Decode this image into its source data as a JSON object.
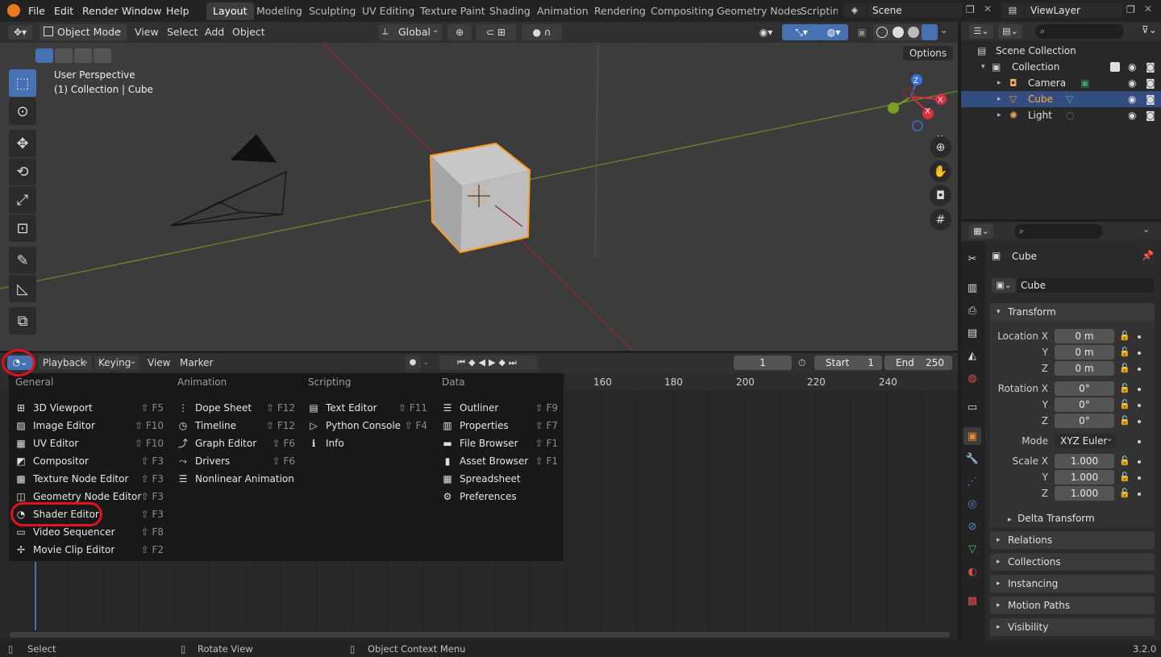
{
  "menubar": {
    "items": [
      "File",
      "Edit",
      "Render",
      "Window",
      "Help"
    ]
  },
  "workspaces": [
    "Layout",
    "Modeling",
    "Sculpting",
    "UV Editing",
    "Texture Paint",
    "Shading",
    "Animation",
    "Rendering",
    "Compositing",
    "Geometry Nodes",
    "Scripting"
  ],
  "scene": {
    "name": "Scene"
  },
  "view_layer": {
    "name": "ViewLayer"
  },
  "viewport_header": {
    "mode": "Object Mode",
    "menus": [
      "View",
      "Select",
      "Add",
      "Object"
    ],
    "orientation": "Global"
  },
  "viewport": {
    "perspective": "User Perspective",
    "context": "(1) Collection | Cube",
    "options": "Options"
  },
  "gizmo": {
    "z": "Z",
    "y": "Y",
    "x": "X"
  },
  "timeline_header": {
    "menus": [
      "Playback",
      "Keying",
      "View",
      "Marker"
    ],
    "current_frame": "1",
    "start_label": "Start",
    "start_value": "1",
    "end_label": "End",
    "end_value": "250"
  },
  "timeline_ticks": [
    "160",
    "180",
    "200",
    "220",
    "240"
  ],
  "editor_menu": {
    "columns": [
      {
        "title": "General",
        "items": [
          {
            "label": "3D Viewport",
            "shortcut": "⇧ F5",
            "icon": "viewport-icon"
          },
          {
            "label": "Image Editor",
            "shortcut": "⇧ F10",
            "icon": "image-icon"
          },
          {
            "label": "UV Editor",
            "shortcut": "⇧ F10",
            "icon": "uv-icon"
          },
          {
            "label": "Compositor",
            "shortcut": "⇧ F3",
            "icon": "compositor-icon"
          },
          {
            "label": "Texture Node Editor",
            "shortcut": "⇧ F3",
            "icon": "texture-icon"
          },
          {
            "label": "Geometry Node Editor",
            "shortcut": "⇧ F3",
            "icon": "geometry-nodes-icon"
          },
          {
            "label": "Shader Editor",
            "shortcut": "⇧ F3",
            "icon": "shader-icon"
          },
          {
            "label": "Video Sequencer",
            "shortcut": "⇧ F8",
            "icon": "sequencer-icon"
          },
          {
            "label": "Movie Clip Editor",
            "shortcut": "⇧ F2",
            "icon": "clip-icon"
          }
        ]
      },
      {
        "title": "Animation",
        "items": [
          {
            "label": "Dope Sheet",
            "shortcut": "⇧ F12",
            "icon": "dopesheet-icon"
          },
          {
            "label": "Timeline",
            "shortcut": "⇧ F12",
            "icon": "timeline-icon"
          },
          {
            "label": "Graph Editor",
            "shortcut": "⇧ F6",
            "icon": "graph-icon"
          },
          {
            "label": "Drivers",
            "shortcut": "⇧ F6",
            "icon": "drivers-icon"
          },
          {
            "label": "Nonlinear Animation",
            "shortcut": "",
            "icon": "nla-icon"
          }
        ]
      },
      {
        "title": "Scripting",
        "items": [
          {
            "label": "Text Editor",
            "shortcut": "⇧ F11",
            "icon": "text-icon"
          },
          {
            "label": "Python Console",
            "shortcut": "⇧ F4",
            "icon": "console-icon"
          },
          {
            "label": "Info",
            "shortcut": "",
            "icon": "info-icon"
          }
        ]
      },
      {
        "title": "Data",
        "items": [
          {
            "label": "Outliner",
            "shortcut": "⇧ F9",
            "icon": "outliner-icon"
          },
          {
            "label": "Properties",
            "shortcut": "⇧ F7",
            "icon": "properties-icon"
          },
          {
            "label": "File Browser",
            "shortcut": "⇧ F1",
            "icon": "filebrowser-icon"
          },
          {
            "label": "Asset Browser",
            "shortcut": "⇧ F1",
            "icon": "asset-icon"
          },
          {
            "label": "Spreadsheet",
            "shortcut": "",
            "icon": "spreadsheet-icon"
          },
          {
            "label": "Preferences",
            "shortcut": "",
            "icon": "preferences-icon"
          }
        ]
      }
    ]
  },
  "outliner": {
    "root": "Scene Collection",
    "collection": "Collection",
    "items": [
      {
        "label": "Camera",
        "selected": false
      },
      {
        "label": "Cube",
        "selected": true
      },
      {
        "label": "Light",
        "selected": false
      }
    ]
  },
  "properties": {
    "object_name": "Cube",
    "data_name": "Cube",
    "transform": "Transform",
    "location_label": "Location X",
    "rotation_label": "Rotation X",
    "scale_label": "Scale X",
    "y": "Y",
    "z": "Z",
    "location": [
      "0 m",
      "0 m",
      "0 m"
    ],
    "rotation": [
      "0°",
      "0°",
      "0°"
    ],
    "scale": [
      "1.000",
      "1.000",
      "1.000"
    ],
    "mode_label": "Mode",
    "mode_value": "XYZ Euler",
    "delta": "Delta Transform",
    "sections": [
      "Relations",
      "Collections",
      "Instancing",
      "Motion Paths",
      "Visibility"
    ]
  },
  "statusbar": {
    "select": "Select",
    "rotate": "Rotate View",
    "context": "Object Context Menu",
    "version": "3.2.0"
  },
  "colors": {
    "accent": "#4671b3",
    "selection_outline": "#ff9a22",
    "annotation_red": "#e0121a",
    "x_axis": "#8c2b34",
    "y_axis": "#6a8a24"
  }
}
